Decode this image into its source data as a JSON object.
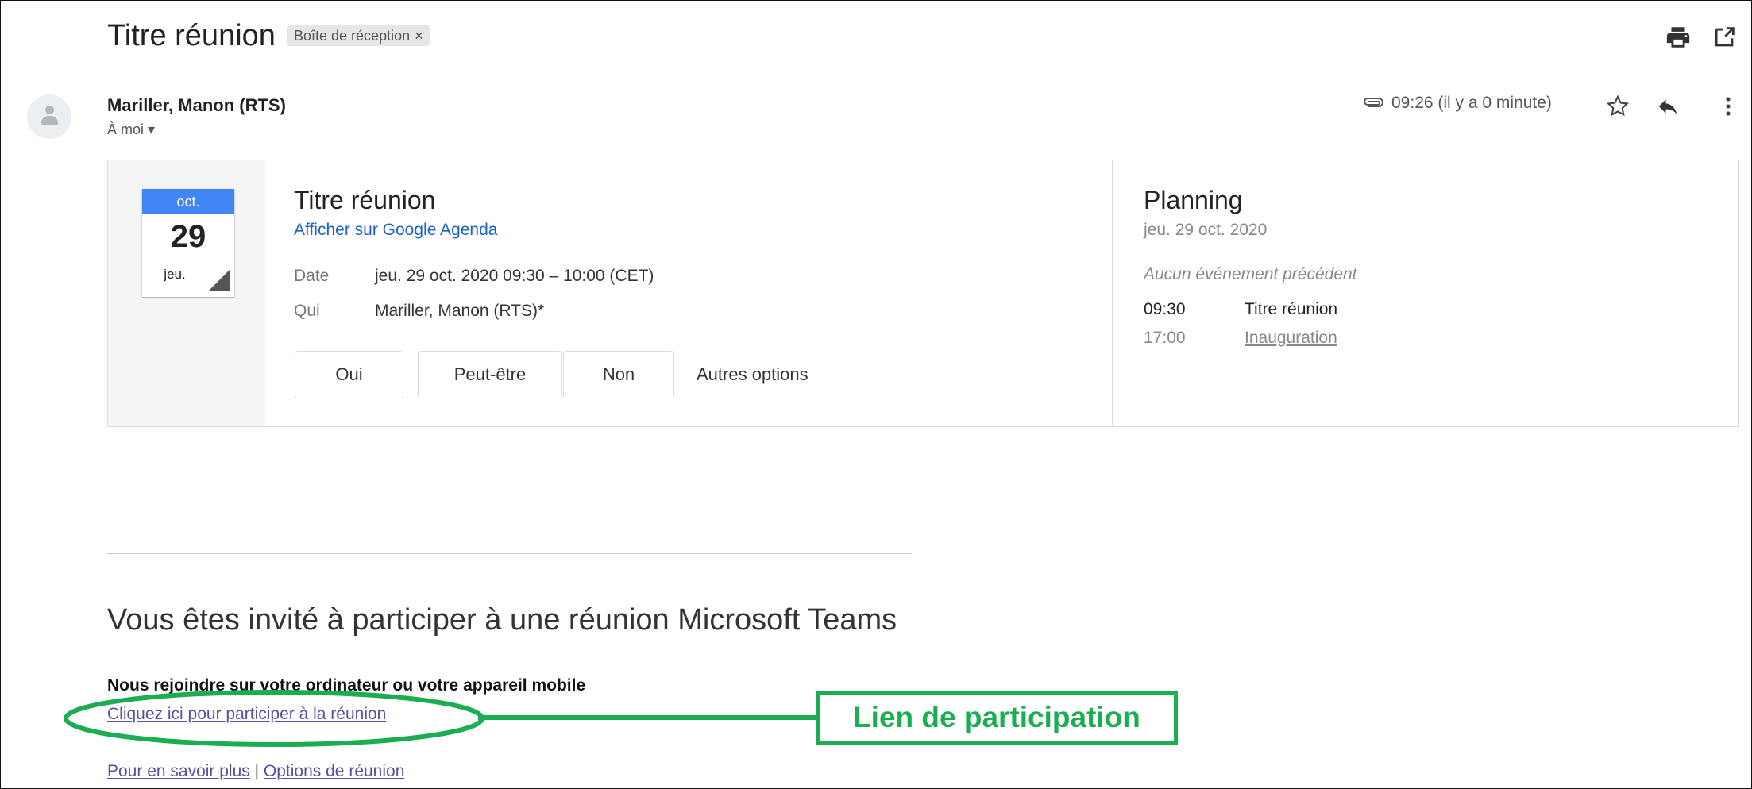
{
  "header": {
    "subject": "Titre réunion",
    "label_chip": "Boîte de réception",
    "label_close": "×",
    "print_icon": "print-icon",
    "open_in_new_icon": "open-in-new-window-icon"
  },
  "message": {
    "sender": "Mariller, Manon (RTS)",
    "recipient": "À moi",
    "recipient_caret": "▾",
    "time": "09:26 (il y a 0 minute)",
    "attachment_icon": "paperclip-icon",
    "star_icon": "star-icon",
    "reply_icon": "reply-icon",
    "more_icon": "more-vertical-icon"
  },
  "invite": {
    "calendar_tile": {
      "month": "oct.",
      "day": "29",
      "weekday": "jeu."
    },
    "title": "Titre réunion",
    "view_link": "Afficher sur Google Agenda",
    "date_label": "Date",
    "date_value": "jeu. 29 oct. 2020 09:30 – 10:00 (CET)",
    "who_label": "Qui",
    "who_value": "Mariller, Manon (RTS)*",
    "rsvp": {
      "yes": "Oui",
      "maybe": "Peut-être",
      "no": "Non",
      "more": "Autres options"
    }
  },
  "planning": {
    "title": "Planning",
    "date": "jeu. 29 oct. 2020",
    "no_previous": "Aucun événement précédent",
    "events": [
      {
        "time": "09:30",
        "title": "Titre réunion"
      },
      {
        "time": "17:00",
        "title": "Inauguration"
      }
    ]
  },
  "body": {
    "invite_heading": "Vous êtes invité à participer à une réunion Microsoft Teams",
    "join_heading": "Nous rejoindre sur votre ordinateur ou votre appareil mobile",
    "join_link": "Cliquez ici pour participer à la réunion",
    "learn_more": "Pour en savoir plus",
    "separator": "|",
    "meeting_options": "Options de réunion"
  },
  "annotation": {
    "label": "Lien de participation",
    "color": "#1aad52"
  },
  "colors": {
    "calendar_blue": "#4285f4",
    "link_blue": "#1a63c4",
    "visited_link": "#5a4ea0"
  }
}
